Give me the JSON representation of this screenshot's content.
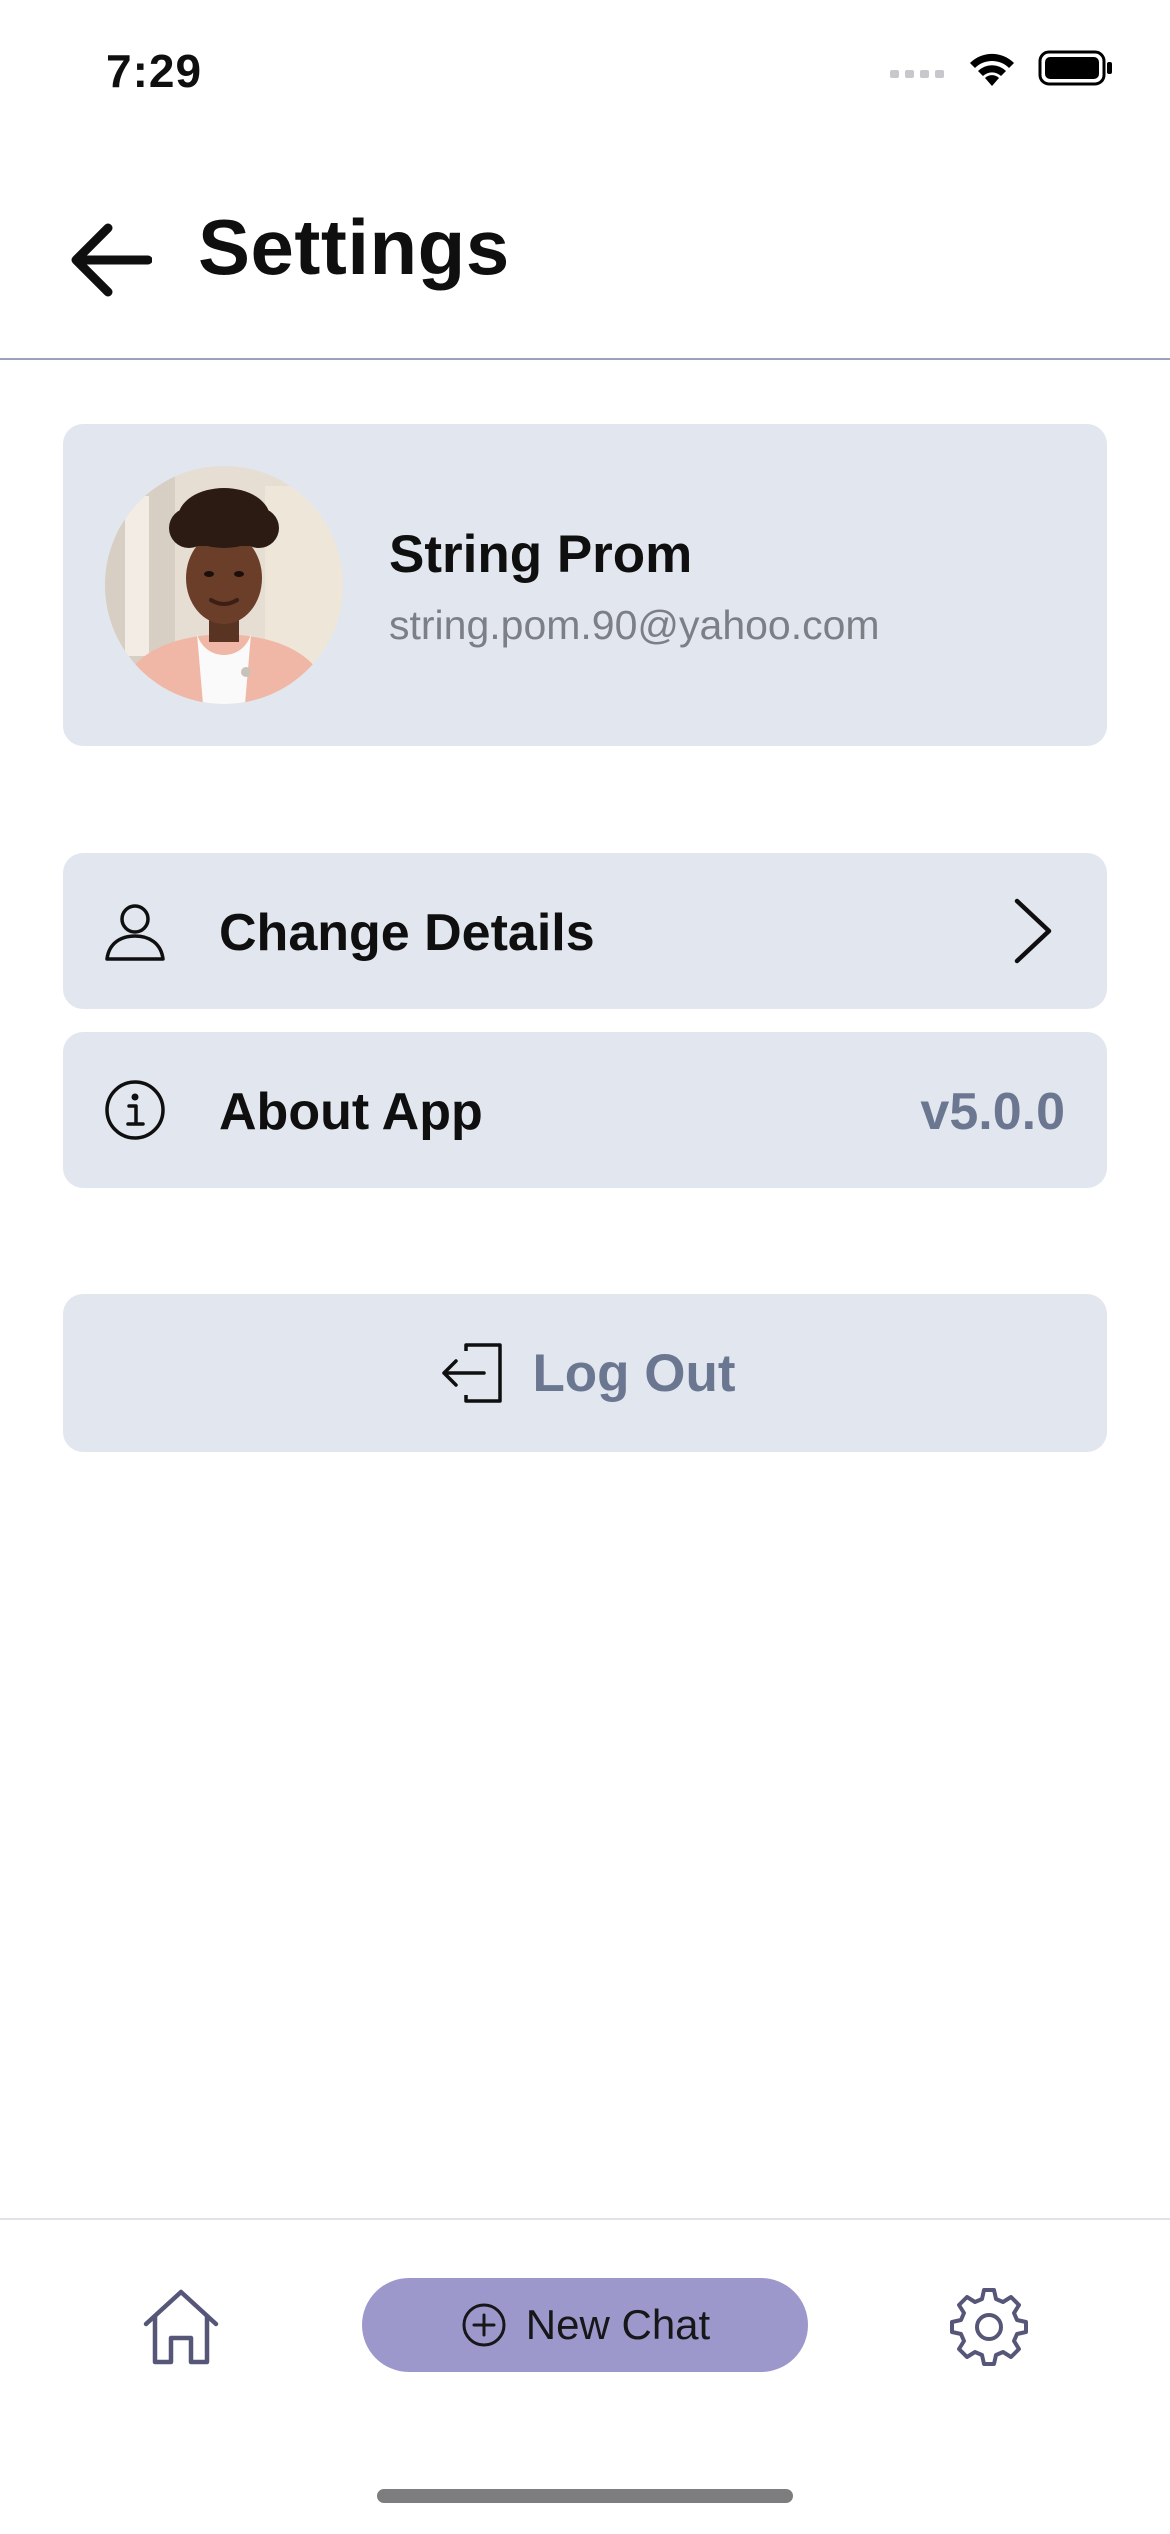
{
  "status_bar": {
    "time": "7:29",
    "icons": [
      "cellular-signal-icon",
      "wifi-icon",
      "battery-icon"
    ]
  },
  "header": {
    "title": "Settings",
    "back_icon": "arrow-left-icon"
  },
  "profile": {
    "name": "String Prom",
    "email": "string.pom.90@yahoo.com",
    "avatar_icon": "avatar-photo"
  },
  "menu": {
    "change_details": {
      "label": "Change Details",
      "icon": "user-icon",
      "trailing_icon": "chevron-right-icon"
    },
    "about_app": {
      "label": "About App",
      "icon": "info-icon",
      "value": "v5.0.0"
    }
  },
  "logout": {
    "label": "Log Out",
    "icon": "logout-icon"
  },
  "tab_bar": {
    "home_icon": "home-icon",
    "new_chat_label": "New Chat",
    "new_chat_icon": "plus-circle-icon",
    "settings_icon": "gear-icon"
  },
  "colors": {
    "card_background": "#e2e7ef",
    "muted_text": "#6b7790",
    "accent": "#9c98cc",
    "divider": "#9aa3ba"
  }
}
